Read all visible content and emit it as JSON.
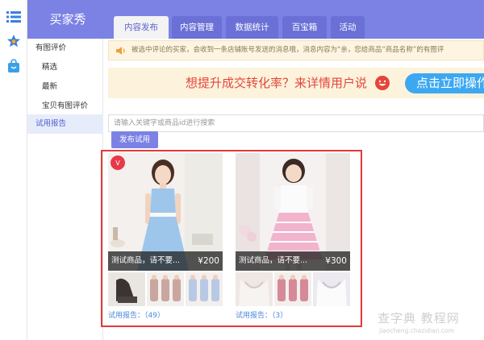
{
  "app": {
    "title": "买家秀"
  },
  "tabs": [
    {
      "label": "内容发布",
      "active": true
    },
    {
      "label": "内容管理",
      "active": false
    },
    {
      "label": "数据统计",
      "active": false
    },
    {
      "label": "百宝箱",
      "active": false
    },
    {
      "label": "活动",
      "active": false
    }
  ],
  "rail": {
    "icons": [
      "list-icon",
      "star-icon",
      "bag-icon"
    ]
  },
  "subnav": [
    {
      "label": "有图评价",
      "indent": 0,
      "active": false
    },
    {
      "label": "精选",
      "indent": 1,
      "active": false
    },
    {
      "label": "最新",
      "indent": 1,
      "active": false
    },
    {
      "label": "宝贝有图评价",
      "indent": 1,
      "active": false
    },
    {
      "label": "试用报告",
      "indent": 0,
      "active": true
    }
  ],
  "notice": {
    "text": "被选中评论的买家，会收到一条店铺账号发送的消息哦，消息内容为“亲，您给商品“商品名称”的有图评"
  },
  "banner": {
    "text": "想提升成交转化率？来详情用户说",
    "button": "点击立即操作"
  },
  "search": {
    "placeholder": "请输入关键字或商品id进行搜索",
    "value": ""
  },
  "publish": {
    "label": "发布试用"
  },
  "cards": [
    {
      "name": "测试商品，请不要...",
      "price": "¥200",
      "report": "试用报告：（49）",
      "badge": "V-logo"
    },
    {
      "name": "测试商品，请不要...",
      "price": "¥300",
      "report": "试用报告：（3）"
    }
  ],
  "watermark": {
    "main": "查字典 教程网",
    "sub": "jiaocheng.chazidian.com"
  },
  "colors": {
    "header": "#7b82e4",
    "tab_active_text": "#5b62d0",
    "highlight": "#e03a3a",
    "link": "#4a8ad8",
    "banner_text": "#e4453a",
    "banner_button": "#3da8f2"
  }
}
